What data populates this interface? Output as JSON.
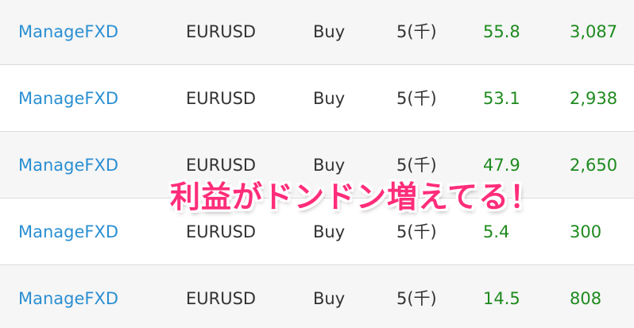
{
  "colors": {
    "link": "#2a8fd2",
    "profit": "#1e8a1e",
    "text": "#333333",
    "overlay": "#ff2d7a"
  },
  "rows": [
    {
      "strategy": "ManageFXD",
      "pair": "EURUSD",
      "side": "Buy",
      "quantity": "5(千)",
      "pips": "55.8",
      "profit": "3,087"
    },
    {
      "strategy": "ManageFXD",
      "pair": "EURUSD",
      "side": "Buy",
      "quantity": "5(千)",
      "pips": "53.1",
      "profit": "2,938"
    },
    {
      "strategy": "ManageFXD",
      "pair": "EURUSD",
      "side": "Buy",
      "quantity": "5(千)",
      "pips": "47.9",
      "profit": "2,650"
    },
    {
      "strategy": "ManageFXD",
      "pair": "EURUSD",
      "side": "Buy",
      "quantity": "5(千)",
      "pips": "5.4",
      "profit": "300"
    },
    {
      "strategy": "ManageFXD",
      "pair": "EURUSD",
      "side": "Buy",
      "quantity": "5(千)",
      "pips": "14.5",
      "profit": "808"
    }
  ],
  "overlay_caption": "利益がドンドン増えてる！"
}
